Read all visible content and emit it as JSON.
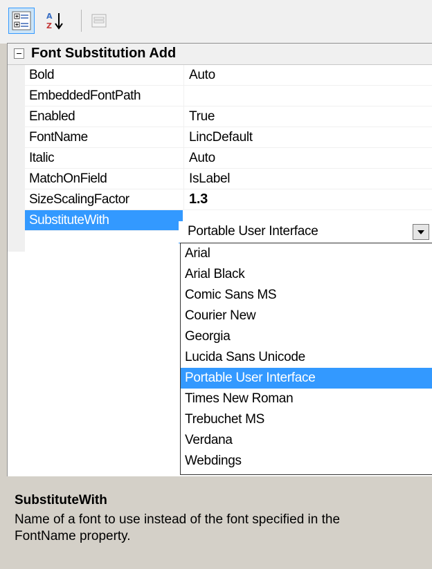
{
  "toolbar": {
    "categorized_icon": "categorized-view-icon",
    "alphabetical_icon": "alphabetical-sort-icon",
    "property_pages_icon": "property-pages-icon"
  },
  "category": {
    "label": "Font Substitution Add",
    "expanded": true
  },
  "properties": [
    {
      "name": "Bold",
      "value": "Auto"
    },
    {
      "name": "EmbeddedFontPath",
      "value": ""
    },
    {
      "name": "Enabled",
      "value": "True"
    },
    {
      "name": "FontName",
      "value": "LincDefault"
    },
    {
      "name": "Italic",
      "value": "Auto"
    },
    {
      "name": "MatchOnField",
      "value": "IsLabel"
    },
    {
      "name": "SizeScalingFactor",
      "value": "1.3"
    },
    {
      "name": "SubstituteWith",
      "value": "Portable User Interface"
    }
  ],
  "dropdown": {
    "selected": "Portable User Interface",
    "options": [
      "Arial",
      "Arial Black",
      "Comic Sans MS",
      "Courier New",
      "Georgia",
      "Lucida Sans Unicode",
      "Portable User Interface",
      "Times New Roman",
      "Trebuchet MS",
      "Verdana",
      "Webdings"
    ]
  },
  "description": {
    "title": "SubstituteWith",
    "text": "Name of a font to use instead of the font specified in the FontName property."
  },
  "colors": {
    "selection": "#3399ff",
    "panel": "#d4d0c8",
    "toolbar": "#f0f0f0"
  }
}
